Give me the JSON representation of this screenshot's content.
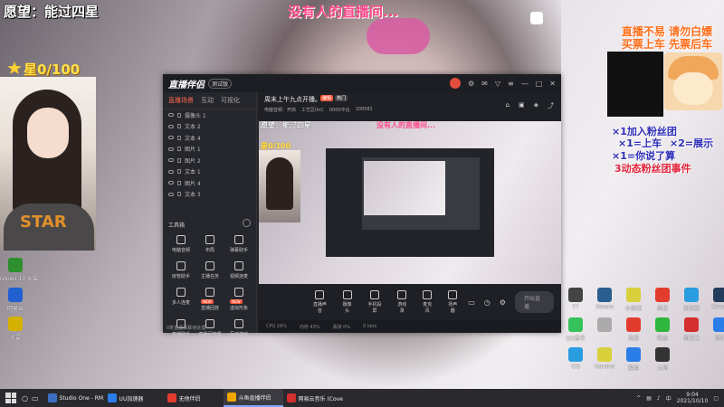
{
  "overlay": {
    "wish": "愿望：能过四星",
    "nobody": "没有人的直播间...",
    "stars": "星0/100",
    "promo": [
      "直播不易 请勿白嫖",
      "买票上车 先票后车"
    ],
    "dedications": [
      "×1加入粉丝团",
      "×1=上车",
      "×2=展示",
      "×1=你说了算",
      "3动态粉丝团事件"
    ]
  },
  "desktop_icons_left": [
    {
      "label": "Windows 10 安装",
      "color": "#2d8f2d"
    },
    {
      "label": "网易云",
      "color": "#2060d0"
    },
    {
      "label": "迅雷",
      "color": "#d4b000"
    },
    {
      "label": "音乐",
      "color": "#f2a600"
    }
  ],
  "desktop_icons_right": [
    {
      "label": "YY",
      "color": "#444444"
    },
    {
      "label": "Steam",
      "color": "#2a5e8f"
    },
    {
      "label": "小游戏",
      "color": "#d8d03a"
    },
    {
      "label": "网易",
      "color": "#e23c2e"
    },
    {
      "label": "浏览器",
      "color": "#2a9de0"
    },
    {
      "label": "Steam",
      "color": "#233c5c"
    },
    {
      "label": "QQ音乐",
      "color": "#36c25a"
    },
    {
      "label": "",
      "color": "#aaaaaa"
    },
    {
      "label": "网易",
      "color": "#e23c2e"
    },
    {
      "label": "微信",
      "color": "#2fb63c"
    },
    {
      "label": "网易云",
      "color": "#d32f2f"
    },
    {
      "label": "腾讯",
      "color": "#2b7de9"
    },
    {
      "label": "QQ",
      "color": "#2a9de0"
    },
    {
      "label": "Garena",
      "color": "#d8d03a"
    },
    {
      "label": "酷狗",
      "color": "#2b7de9"
    },
    {
      "label": "大师",
      "color": "#333333"
    }
  ],
  "app": {
    "name": "直播伴侣",
    "badge": "测试版",
    "tabs": [
      "直播场景",
      "互动",
      "可视化"
    ],
    "layers": [
      "摄像头 1",
      "文本 2",
      "文本 4",
      "图片 1",
      "图片 2",
      "文本 1",
      "图片 4",
      "文本 3"
    ],
    "toolbox_title": "工具箱",
    "tools": [
      {
        "label": "电脑音频",
        "badge": ""
      },
      {
        "label": "布局",
        "badge": ""
      },
      {
        "label": "弹幕助手",
        "badge": ""
      },
      {
        "label": "房管助手",
        "badge": ""
      },
      {
        "label": "主播任务",
        "badge": ""
      },
      {
        "label": "视频连麦",
        "badge": ""
      },
      {
        "label": "多人连麦",
        "badge": ""
      },
      {
        "label": "直播回放",
        "badge": "NEW"
      },
      {
        "label": "虚拟形象",
        "badge": "NEW"
      },
      {
        "label": "直播助手",
        "badge": ""
      },
      {
        "label": "直播间管理",
        "badge": ""
      },
      {
        "label": "互动游戏",
        "badge": ""
      }
    ],
    "status_left": "0条直播弹幕待处理",
    "info_title": "周末上午九点开播。",
    "info_edit": "编辑",
    "info_tag": "热门",
    "info_sub": [
      "电脑音频：开启",
      "工艺区0nC",
      "0000平台",
      "100581"
    ],
    "preview": {
      "wish": "愿望：能过四星",
      "nobody": "没有人的直播间...",
      "stars": "星0/100"
    },
    "controls": [
      "直播声音",
      "摄像头",
      "手机投屏",
      "游戏录",
      "麦克风",
      "扬声器"
    ],
    "start_button": "开始直播",
    "statusbar": [
      "CPU 24%",
      "内存 43%",
      "丢帧 0%",
      "0 kb/s"
    ]
  },
  "taskbar": {
    "items": [
      {
        "label": "Studio One - RM...",
        "color": "#3b6fc0",
        "active": false
      },
      {
        "label": "UU加速器",
        "color": "#2b7de9",
        "active": false
      },
      {
        "label": "无他伴侣",
        "color": "#e23c2e",
        "active": false
      },
      {
        "label": "斗鱼直播伴侣",
        "color": "#f2a600",
        "active": true
      },
      {
        "label": "网易云音乐 (Cover...",
        "color": "#d32f2f",
        "active": false
      }
    ],
    "time": "9:04",
    "date": "2021/10/10"
  }
}
